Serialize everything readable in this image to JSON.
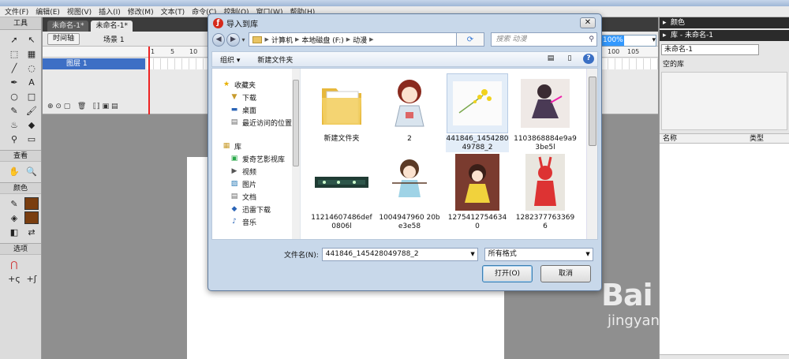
{
  "app": {
    "menu": [
      "文件(F)",
      "编辑(E)",
      "视图(V)",
      "插入(I)",
      "修改(M)",
      "文本(T)",
      "命令(C)",
      "控制(O)",
      "窗口(W)",
      "帮助(H)"
    ],
    "toolbox": {
      "title": "工具",
      "view": "查看",
      "color": "颜色",
      "options": "选项"
    },
    "doc_tabs": [
      "未命名-1*",
      "未命名-1*"
    ],
    "timeline_button": "时间轴",
    "scene": "场景 1",
    "zoom": "100%",
    "layer_name": "图层 1",
    "frame_ticks": [
      "1",
      "5",
      "10",
      "100",
      "105"
    ],
    "right_panel": {
      "color_header": "颜色",
      "library_header": "库 - 未命名-1",
      "library_select": "未命名-1",
      "empty_library": "空的库",
      "col_name": "名称",
      "col_type": "类型"
    }
  },
  "dialog": {
    "title": "导入到库",
    "path": [
      "计算机",
      "本地磁盘 (F:)",
      "动漫"
    ],
    "search_placeholder": "搜索 动漫",
    "commands": {
      "organize": "组织 ▾",
      "new_folder": "新建文件夹"
    },
    "nav": {
      "favorites": "收藏夹",
      "favorites_items": [
        "下载",
        "桌面",
        "最近访问的位置"
      ],
      "library": "库",
      "library_items": [
        "爱奇艺影视库",
        "视频",
        "图片",
        "文档",
        "迅雷下载",
        "音乐"
      ]
    },
    "files": [
      {
        "name": "新建文件夹",
        "kind": "folder"
      },
      {
        "name": "2",
        "kind": "image"
      },
      {
        "name": "441846_145428049788_2",
        "kind": "image",
        "selected": true
      },
      {
        "name": "1103868884e9a93be5l",
        "kind": "image"
      },
      {
        "name": "11214607486def0806l",
        "kind": "image"
      },
      {
        "name": "1004947960 20be3e58",
        "kind": "image"
      },
      {
        "name": "12754127546340",
        "kind": "image"
      },
      {
        "name": "12823777633696",
        "kind": "image"
      }
    ],
    "filename_label": "文件名(N):",
    "filename_value": "441846_145428049788_2",
    "filetype_value": "所有格式",
    "open_button": "打开(O)",
    "cancel_button": "取消"
  },
  "watermark": {
    "logo": "Bai du 经验",
    "url": "jingyan.baidu.com"
  },
  "colors": {
    "dialog_frame": "#c8d8ea",
    "selection": "#e3edf8",
    "layer_highlight": "#3d6fc5",
    "playhead": "#ee2222"
  }
}
